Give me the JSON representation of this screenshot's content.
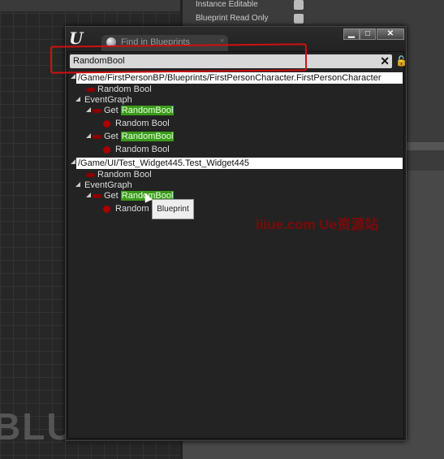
{
  "background": {
    "watermark": "BLUEPRINT"
  },
  "properties": {
    "instance_editable": "Instance Editable",
    "blueprint_read_only": "Blueprint Read Only",
    "instance_editable_checked": false,
    "blueprint_read_only_checked": false
  },
  "window": {
    "logo": "U",
    "tab_label": "Find in Blueprints",
    "tab_close": "×",
    "minimize": "▁",
    "maximize": "□",
    "close": "✕"
  },
  "search": {
    "value": "RandomBool",
    "clear": "✕",
    "lock_icon": "lock-open-icon"
  },
  "results": [
    {
      "path": "/Game/FirstPersonBP/Blueprints/FirstPersonCharacter.FirstPersonCharacter",
      "variable": "Random Bool",
      "graph": "EventGraph",
      "nodes": [
        {
          "prefix": "Get ",
          "match": "RandomBool",
          "pin": "Random Bool"
        },
        {
          "prefix": "Get ",
          "match": "RandomBool",
          "pin": "Random Bool"
        }
      ]
    },
    {
      "path": "/Game/UI/Test_Widget445.Test_Widget445",
      "variable": "Random Bool",
      "graph": "EventGraph",
      "nodes": [
        {
          "prefix": "Get ",
          "match": "RandomBool",
          "pin": "Random Bool"
        }
      ]
    }
  ],
  "tooltip": "Blueprint",
  "watermark": "iiiue.com  Ue资源站",
  "colors": {
    "highlight": "#3a9a1a",
    "pin": "#a00000",
    "annotation": "#d01010"
  }
}
